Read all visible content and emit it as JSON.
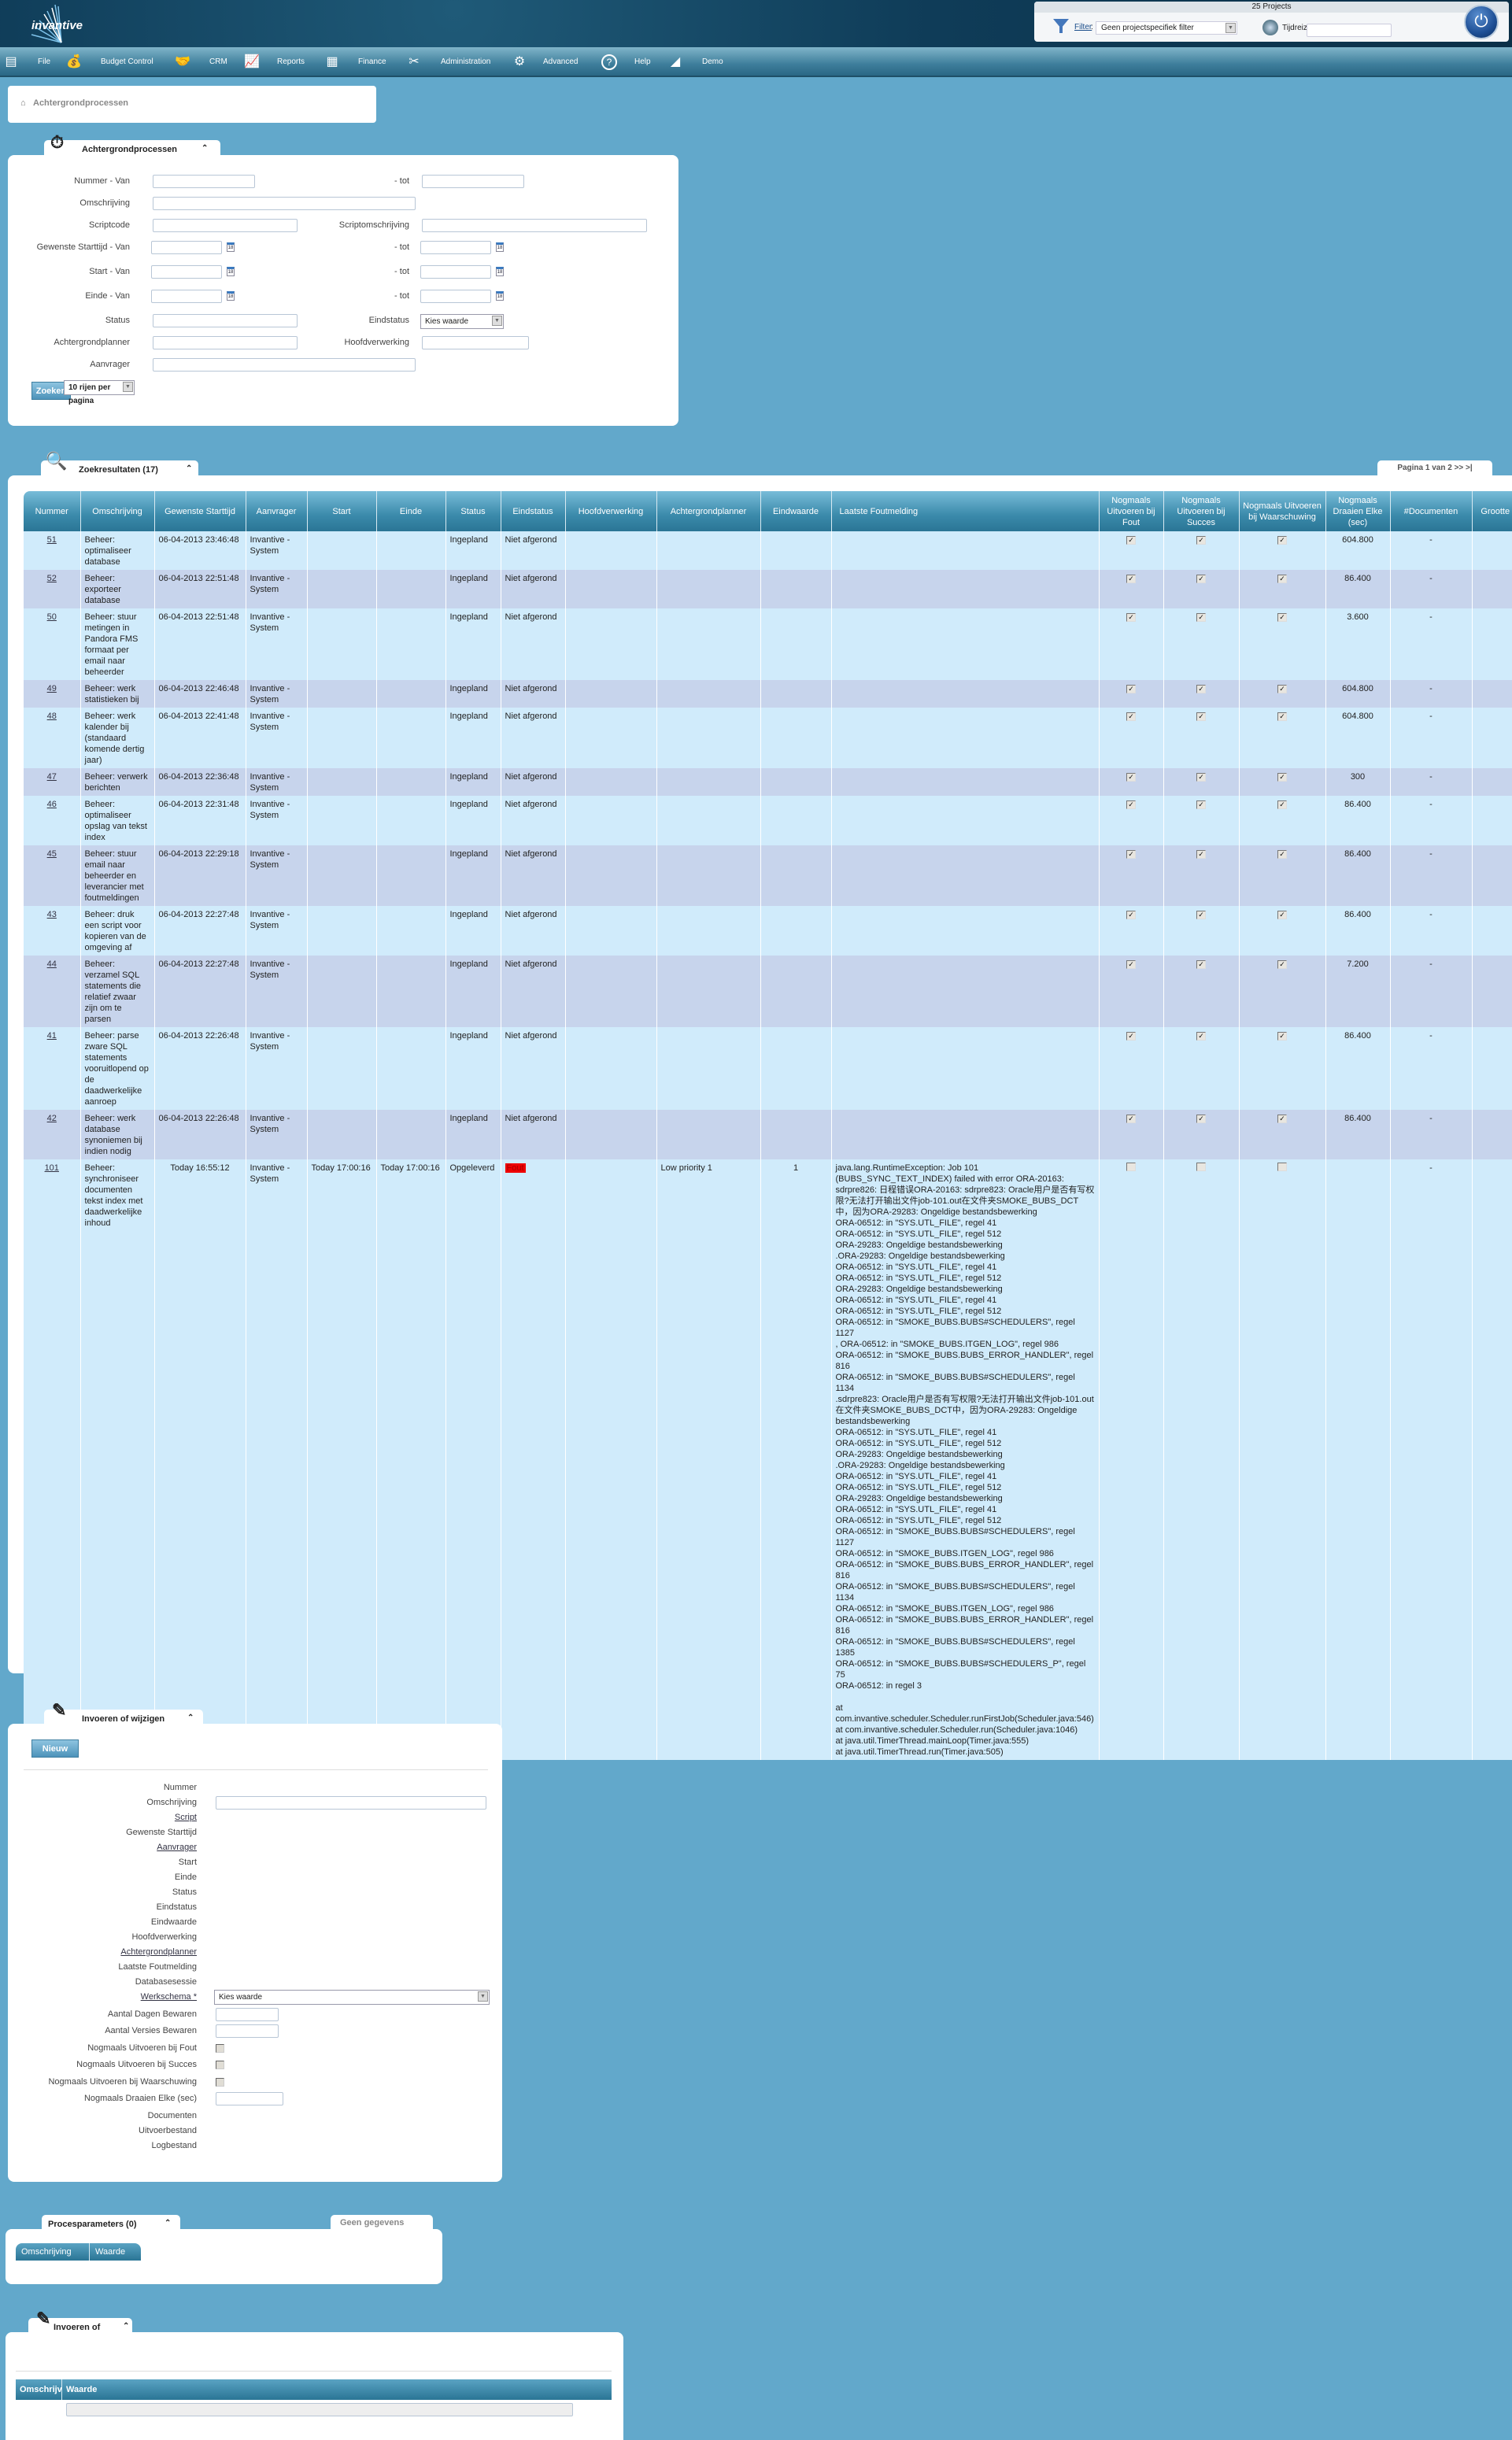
{
  "header": {
    "logo_text": "invantive",
    "projects_title": "25 Projects",
    "filter_link": "Filter",
    "filter_colon": ":",
    "filter_value": "Geen projectspecifiek filter",
    "time_travel_label": "Tijdreizen naar:",
    "time_travel_value": ""
  },
  "menu": [
    {
      "label": "File",
      "icon": "file-cabinet-icon"
    },
    {
      "label": "Budget Control",
      "icon": "money-bag-icon"
    },
    {
      "label": "CRM",
      "icon": "handshake-icon"
    },
    {
      "label": "Reports",
      "icon": "presentation-board-icon"
    },
    {
      "label": "Finance",
      "icon": "calculator-icon"
    },
    {
      "label": "Administration",
      "icon": "tools-icon"
    },
    {
      "label": "Advanced",
      "icon": "gears-icon"
    },
    {
      "label": "Help",
      "icon": "help-icon"
    },
    {
      "label": "Demo",
      "icon": "demo-logo-icon"
    }
  ],
  "breadcrumb": {
    "label": "Achtergrondprocessen"
  },
  "search_panel": {
    "title": "Achtergrondprocessen",
    "fields": {
      "nummer_van": "Nummer - Van",
      "tot": "- tot",
      "omschrijving": "Omschrijving",
      "scriptcode": "Scriptcode",
      "scriptomschrijving": "Scriptomschrijving",
      "gewenste_starttijd_van": "Gewenste Starttijd - Van",
      "start_van": "Start - Van",
      "einde_van": "Einde - Van",
      "status": "Status",
      "eindstatus": "Eindstatus",
      "achtergrondplanner": "Achtergrondplanner",
      "hoofdverwerking": "Hoofdverwerking",
      "aanvrager": "Aanvrager"
    },
    "eindstatus_value": "Kies waarde",
    "calendar_day": "18",
    "search_button": "Zoeken",
    "rows_per_page": "10 rijen per pagina"
  },
  "results": {
    "title": "Zoekresultaten (17)",
    "pager": "Pagina 1 van 2 >> >|",
    "columns": [
      "Nummer",
      "Omschrijving",
      "Gewenste Starttijd",
      "Aanvrager",
      "Start",
      "Einde",
      "Status",
      "Eindstatus",
      "Hoofdverwerking",
      "Achtergrondplanner",
      "Eindwaarde",
      "Laatste Foutmelding",
      "Nogmaals Uitvoeren bij Fout",
      "Nogmaals Uitvoeren bij Succes",
      "Nogmaals Uitvoeren bij Waarschuwing",
      "Nogmaals Draaien Elke (sec)",
      "#Documenten",
      "Grootte"
    ],
    "rows": [
      {
        "nummer": "51",
        "omschrijving": "Beheer: optimaliseer database",
        "gewenste_starttijd": "06-04-2013 23:46:48",
        "aanvrager": "Invantive - System",
        "start": "",
        "einde": "",
        "status": "Ingepland",
        "eindstatus": "Niet afgerond",
        "hoofdverwerking": "",
        "achtergrondplanner": "",
        "eindwaarde": "",
        "foutmelding": "",
        "fout": true,
        "succes": true,
        "waarschuwing": true,
        "draaien_elke": "604.800",
        "documenten": "-",
        "grootte": ""
      },
      {
        "nummer": "52",
        "omschrijving": "Beheer: exporteer database",
        "gewenste_starttijd": "06-04-2013 22:51:48",
        "aanvrager": "Invantive - System",
        "start": "",
        "einde": "",
        "status": "Ingepland",
        "eindstatus": "Niet afgerond",
        "hoofdverwerking": "",
        "achtergrondplanner": "",
        "eindwaarde": "",
        "foutmelding": "",
        "fout": true,
        "succes": true,
        "waarschuwing": true,
        "draaien_elke": "86.400",
        "documenten": "-",
        "grootte": ""
      },
      {
        "nummer": "50",
        "omschrijving": "Beheer: stuur metingen in Pandora FMS formaat per email naar beheerder",
        "gewenste_starttijd": "06-04-2013 22:51:48",
        "aanvrager": "Invantive - System",
        "start": "",
        "einde": "",
        "status": "Ingepland",
        "eindstatus": "Niet afgerond",
        "hoofdverwerking": "",
        "achtergrondplanner": "",
        "eindwaarde": "",
        "foutmelding": "",
        "fout": true,
        "succes": true,
        "waarschuwing": true,
        "draaien_elke": "3.600",
        "documenten": "-",
        "grootte": ""
      },
      {
        "nummer": "49",
        "omschrijving": "Beheer: werk statistieken bij",
        "gewenste_starttijd": "06-04-2013 22:46:48",
        "aanvrager": "Invantive - System",
        "start": "",
        "einde": "",
        "status": "Ingepland",
        "eindstatus": "Niet afgerond",
        "hoofdverwerking": "",
        "achtergrondplanner": "",
        "eindwaarde": "",
        "foutmelding": "",
        "fout": true,
        "succes": true,
        "waarschuwing": true,
        "draaien_elke": "604.800",
        "documenten": "-",
        "grootte": ""
      },
      {
        "nummer": "48",
        "omschrijving": "Beheer: werk kalender bij (standaard komende dertig jaar)",
        "gewenste_starttijd": "06-04-2013 22:41:48",
        "aanvrager": "Invantive - System",
        "start": "",
        "einde": "",
        "status": "Ingepland",
        "eindstatus": "Niet afgerond",
        "hoofdverwerking": "",
        "achtergrondplanner": "",
        "eindwaarde": "",
        "foutmelding": "",
        "fout": true,
        "succes": true,
        "waarschuwing": true,
        "draaien_elke": "604.800",
        "documenten": "-",
        "grootte": ""
      },
      {
        "nummer": "47",
        "omschrijving": "Beheer: verwerk berichten",
        "gewenste_starttijd": "06-04-2013 22:36:48",
        "aanvrager": "Invantive - System",
        "start": "",
        "einde": "",
        "status": "Ingepland",
        "eindstatus": "Niet afgerond",
        "hoofdverwerking": "",
        "achtergrondplanner": "",
        "eindwaarde": "",
        "foutmelding": "",
        "fout": true,
        "succes": true,
        "waarschuwing": true,
        "draaien_elke": "300",
        "documenten": "-",
        "grootte": ""
      },
      {
        "nummer": "46",
        "omschrijving": "Beheer: optimaliseer opslag van tekst index",
        "gewenste_starttijd": "06-04-2013 22:31:48",
        "aanvrager": "Invantive - System",
        "start": "",
        "einde": "",
        "status": "Ingepland",
        "eindstatus": "Niet afgerond",
        "hoofdverwerking": "",
        "achtergrondplanner": "",
        "eindwaarde": "",
        "foutmelding": "",
        "fout": true,
        "succes": true,
        "waarschuwing": true,
        "draaien_elke": "86.400",
        "documenten": "-",
        "grootte": ""
      },
      {
        "nummer": "45",
        "omschrijving": "Beheer: stuur email naar beheerder en leverancier met foutmeldingen",
        "gewenste_starttijd": "06-04-2013 22:29:18",
        "aanvrager": "Invantive - System",
        "start": "",
        "einde": "",
        "status": "Ingepland",
        "eindstatus": "Niet afgerond",
        "hoofdverwerking": "",
        "achtergrondplanner": "",
        "eindwaarde": "",
        "foutmelding": "",
        "fout": true,
        "succes": true,
        "waarschuwing": true,
        "draaien_elke": "86.400",
        "documenten": "-",
        "grootte": ""
      },
      {
        "nummer": "43",
        "omschrijving": "Beheer: druk een script voor kopieren van de omgeving af",
        "gewenste_starttijd": "06-04-2013 22:27:48",
        "aanvrager": "Invantive - System",
        "start": "",
        "einde": "",
        "status": "Ingepland",
        "eindstatus": "Niet afgerond",
        "hoofdverwerking": "",
        "achtergrondplanner": "",
        "eindwaarde": "",
        "foutmelding": "",
        "fout": true,
        "succes": true,
        "waarschuwing": true,
        "draaien_elke": "86.400",
        "documenten": "-",
        "grootte": ""
      },
      {
        "nummer": "44",
        "omschrijving": "Beheer: verzamel SQL statements die relatief zwaar zijn om te parsen",
        "gewenste_starttijd": "06-04-2013 22:27:48",
        "aanvrager": "Invantive - System",
        "start": "",
        "einde": "",
        "status": "Ingepland",
        "eindstatus": "Niet afgerond",
        "hoofdverwerking": "",
        "achtergrondplanner": "",
        "eindwaarde": "",
        "foutmelding": "",
        "fout": true,
        "succes": true,
        "waarschuwing": true,
        "draaien_elke": "7.200",
        "documenten": "-",
        "grootte": ""
      },
      {
        "nummer": "41",
        "omschrijving": "Beheer: parse zware SQL statements vooruitlopend op de daadwerkelijke aanroep",
        "gewenste_starttijd": "06-04-2013 22:26:48",
        "aanvrager": "Invantive - System",
        "start": "",
        "einde": "",
        "status": "Ingepland",
        "eindstatus": "Niet afgerond",
        "hoofdverwerking": "",
        "achtergrondplanner": "",
        "eindwaarde": "",
        "foutmelding": "",
        "fout": true,
        "succes": true,
        "waarschuwing": true,
        "draaien_elke": "86.400",
        "documenten": "-",
        "grootte": ""
      },
      {
        "nummer": "42",
        "omschrijving": "Beheer: werk database synoniemen bij indien nodig",
        "gewenste_starttijd": "06-04-2013 22:26:48",
        "aanvrager": "Invantive - System",
        "start": "",
        "einde": "",
        "status": "Ingepland",
        "eindstatus": "Niet afgerond",
        "hoofdverwerking": "",
        "achtergrondplanner": "",
        "eindwaarde": "",
        "foutmelding": "",
        "fout": true,
        "succes": true,
        "waarschuwing": true,
        "draaien_elke": "86.400",
        "documenten": "-",
        "grootte": ""
      },
      {
        "nummer": "101",
        "omschrijving": "Beheer: synchroniseer documenten tekst index met daadwerkelijke inhoud",
        "gewenste_starttijd": "Today 16:55:12",
        "aanvrager": "Invantive - System",
        "start": "Today 17:00:16",
        "einde": "Today 17:00:16",
        "status": "Opgeleverd",
        "eindstatus": "Fout",
        "hoofdverwerking": "",
        "achtergrondplanner": "Low priority 1",
        "eindwaarde": "1",
        "foutmelding": "java.lang.RuntimeException: Job 101 (BUBS_SYNC_TEXT_INDEX) failed with error ORA-20163: sdrpre826: 日程错误ORA-20163: sdrpre823: Oracle用户是否有写权限?无法打开输出文件job-101.out在文件夹SMOKE_BUBS_DCT中，因为ORA-29283: Ongeldige bestandsbewerking\nORA-06512: in \"SYS.UTL_FILE\", regel 41\nORA-06512: in \"SYS.UTL_FILE\", regel 512\nORA-29283: Ongeldige bestandsbewerking\n.ORA-29283: Ongeldige bestandsbewerking\nORA-06512: in \"SYS.UTL_FILE\", regel 41\nORA-06512: in \"SYS.UTL_FILE\", regel 512\nORA-29283: Ongeldige bestandsbewerking\nORA-06512: in \"SYS.UTL_FILE\", regel 41\nORA-06512: in \"SYS.UTL_FILE\", regel 512\nORA-06512: in \"SMOKE_BUBS.BUBS#SCHEDULERS\", regel 1127\n, ORA-06512: in \"SMOKE_BUBS.ITGEN_LOG\", regel 986\nORA-06512: in \"SMOKE_BUBS.BUBS_ERROR_HANDLER\", regel 816\nORA-06512: in \"SMOKE_BUBS.BUBS#SCHEDULERS\", regel 1134\n.sdrpre823: Oracle用户是否有写权限?无法打开输出文件job-101.out在文件夹SMOKE_BUBS_DCT中，因为ORA-29283: Ongeldige bestandsbewerking\nORA-06512: in \"SYS.UTL_FILE\", regel 41\nORA-06512: in \"SYS.UTL_FILE\", regel 512\nORA-29283: Ongeldige bestandsbewerking\n.ORA-29283: Ongeldige bestandsbewerking\nORA-06512: in \"SYS.UTL_FILE\", regel 41\nORA-06512: in \"SYS.UTL_FILE\", regel 512\nORA-29283: Ongeldige bestandsbewerking\nORA-06512: in \"SYS.UTL_FILE\", regel 41\nORA-06512: in \"SYS.UTL_FILE\", regel 512\nORA-06512: in \"SMOKE_BUBS.BUBS#SCHEDULERS\", regel 1127\nORA-06512: in \"SMOKE_BUBS.ITGEN_LOG\", regel 986\nORA-06512: in \"SMOKE_BUBS.BUBS_ERROR_HANDLER\", regel 816\nORA-06512: in \"SMOKE_BUBS.BUBS#SCHEDULERS\", regel 1134\nORA-06512: in \"SMOKE_BUBS.ITGEN_LOG\", regel 986\nORA-06512: in \"SMOKE_BUBS.BUBS_ERROR_HANDLER\", regel 816\nORA-06512: in \"SMOKE_BUBS.BUBS#SCHEDULERS\", regel 1385\nORA-06512: in \"SMOKE_BUBS.BUBS#SCHEDULERS_P\", regel 75\nORA-06512: in regel 3\n\nat com.invantive.scheduler.Scheduler.runFirstJob(Scheduler.java:546)\nat com.invantive.scheduler.Scheduler.run(Scheduler.java:1046)\nat java.util.TimerThread.mainLoop(Timer.java:555)\nat java.util.TimerThread.run(Timer.java:505)",
        "fout": false,
        "succes": false,
        "waarschuwing": false,
        "draaien_elke": "",
        "documenten": "-",
        "grootte": ""
      }
    ]
  },
  "edit_panel": {
    "title": "Invoeren of wijzigen",
    "new_button": "Nieuw",
    "labels": [
      "Nummer",
      "Omschrijving",
      "Script",
      "Gewenste Starttijd",
      "Aanvrager",
      "Start",
      "Einde",
      "Status",
      "Eindstatus",
      "Eindwaarde",
      "Hoofdverwerking",
      "Achtergrondplanner",
      "Laatste Foutmelding",
      "Databasesessie",
      "Werkschema *",
      "Aantal Dagen Bewaren",
      "Aantal Versies Bewaren",
      "Nogmaals Uitvoeren bij Fout",
      "Nogmaals Uitvoeren bij Succes",
      "Nogmaals Uitvoeren bij Waarschuwing",
      "Nogmaals Draaien Elke (sec)",
      "Documenten",
      "Uitvoerbestand",
      "Logbestand"
    ],
    "werkschema_value": "Kies waarde"
  },
  "params_panel": {
    "title": "Procesparameters (0)",
    "no_data": "Geen gegevens",
    "columns": [
      "Omschrijving",
      "Waarde"
    ]
  },
  "edit_panel_2": {
    "title": "Invoeren of wijzigen",
    "columns": [
      "Omschrijving",
      "Waarde"
    ]
  }
}
